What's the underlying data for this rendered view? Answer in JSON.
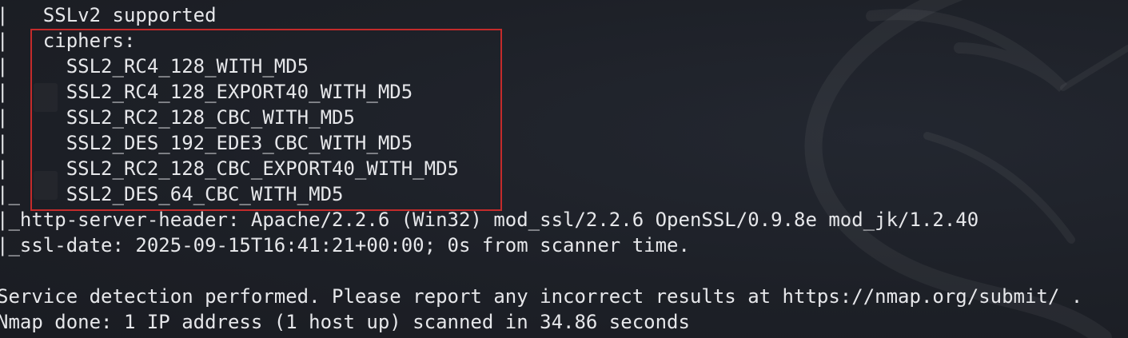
{
  "terminal": {
    "lines": [
      "|   SSLv2 supported",
      "|   ciphers:",
      "|     SSL2_RC4_128_WITH_MD5",
      "|     SSL2_RC4_128_EXPORT40_WITH_MD5",
      "|     SSL2_RC2_128_CBC_WITH_MD5",
      "|     SSL2_DES_192_EDE3_CBC_WITH_MD5",
      "|     SSL2_RC2_128_CBC_EXPORT40_WITH_MD5",
      "|_    SSL2_DES_64_CBC_WITH_MD5",
      "|_http-server-header: Apache/2.2.6 (Win32) mod_ssl/2.2.6 OpenSSL/0.9.8e mod_jk/1.2.40",
      "|_ssl-date: 2025-09-15T16:41:21+00:00; 0s from scanner time.",
      "",
      "Service detection performed. Please report any incorrect results at https://nmap.org/submit/ .",
      "Nmap done: 1 IP address (1 host up) scanned in 34.86 seconds"
    ],
    "colors": {
      "background": "#1c1f26",
      "text": "#e6e7ea",
      "highlight": "#c42b2b"
    }
  }
}
